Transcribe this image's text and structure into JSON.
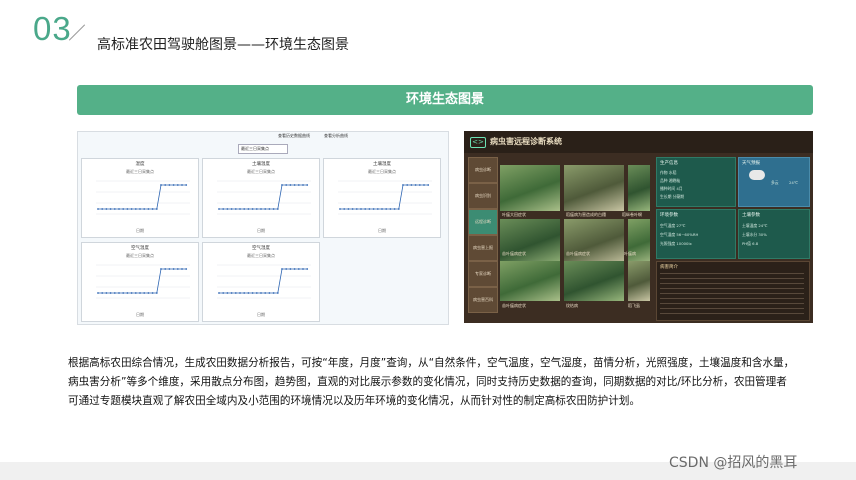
{
  "slide": {
    "number": "03",
    "title": "高标准农田驾驶舱图景——环境生态图景",
    "banner": "环境生态图景"
  },
  "left_screenshot": {
    "tabs": [
      "查看历史数据曲线",
      "查看分析曲线"
    ],
    "selector": "最近三日采集点",
    "charts": [
      {
        "title": "湿度",
        "subtitle": "最近三日采集点",
        "xlabel": "日期",
        "ylabel": ""
      },
      {
        "title": "土壤温度",
        "subtitle": "最近三日采集点",
        "xlabel": "日期",
        "ylabel": "温度"
      },
      {
        "title": "土壤湿度",
        "subtitle": "最近三日采集点",
        "xlabel": "日期",
        "ylabel": ""
      },
      {
        "title": "空气温度",
        "subtitle": "最近三日采集点",
        "xlabel": "日期",
        "ylabel": "空气温度"
      },
      {
        "title": "空气湿度",
        "subtitle": "最近三日采集点",
        "xlabel": "日期",
        "ylabel": "空气湿度"
      }
    ]
  },
  "right_screenshot": {
    "title": "病虫害远程诊断系统",
    "side_items": [
      "病虫诊断",
      "病虫识别",
      "远程诊断",
      "病虫害上报",
      "专家诊断",
      "病虫害百科"
    ],
    "photos": [
      "叶瘟大田症状",
      "稻瘟病为害造成的白穗",
      "稻纵卷叶螟",
      "苗叶瘟病症状",
      "苗叶瘟病症状",
      "叶瘟病",
      "苗叶瘟病症状",
      "纹枯病",
      "稻飞虱"
    ],
    "crop_panel": {
      "title": "生产信息",
      "rows": [
        "作物  水稻",
        "品种  湘晚籼",
        "播种时间  4月",
        "生长期  分蘖期"
      ]
    },
    "weather_panel": {
      "title": "天气预报",
      "condition": "多云",
      "temp": "24℃"
    },
    "env_panel": {
      "title": "环境参数",
      "rows": [
        "空气温度  27℃",
        "空气湿度  56~60%RH",
        "光照强度  10000lx"
      ]
    },
    "soil_panel": {
      "title": "土壤参数",
      "rows": [
        "土壤温度  24℃",
        "土壤水分  30%",
        "PH值  6.8"
      ]
    },
    "notice_title": "病害简介"
  },
  "description": [
    "根据高标农田综合情况，生成农田数据分析报告，可按“年度，月度”查询，从“自然条件，空气温度，空气湿度，苗情分析，光照强度，土壤温度和含水量，",
    "病虫害分析”等多个维度，采用散点分布图，趋势图，直观的对比展示参数的变化情况，同时支持历史数据的查询，同期数据的对比/环比分析，农田管理者",
    "可通过专题模块直观了解农田全域内及小范围的环境情况以及历年环境的变化情况，从而针对性的制定高标农田防护计划。"
  ],
  "watermark": "CSDN @招风的黑耳",
  "colors": {
    "accent": "#54b088",
    "number": "#4aa88a",
    "dark_panel": "#3c2d22",
    "teal_panel": "#1e5a4c"
  }
}
